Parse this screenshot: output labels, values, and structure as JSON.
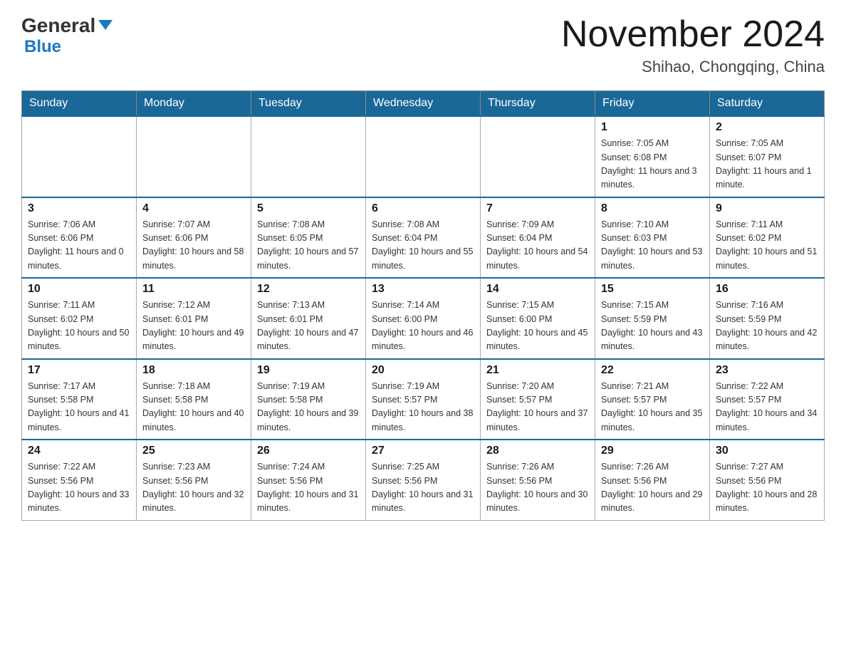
{
  "logo": {
    "text1": "General",
    "text2": "Blue"
  },
  "header": {
    "title": "November 2024",
    "subtitle": "Shihao, Chongqing, China"
  },
  "days_of_week": [
    "Sunday",
    "Monday",
    "Tuesday",
    "Wednesday",
    "Thursday",
    "Friday",
    "Saturday"
  ],
  "weeks": [
    [
      {
        "day": "",
        "info": ""
      },
      {
        "day": "",
        "info": ""
      },
      {
        "day": "",
        "info": ""
      },
      {
        "day": "",
        "info": ""
      },
      {
        "day": "",
        "info": ""
      },
      {
        "day": "1",
        "info": "Sunrise: 7:05 AM\nSunset: 6:08 PM\nDaylight: 11 hours and 3 minutes."
      },
      {
        "day": "2",
        "info": "Sunrise: 7:05 AM\nSunset: 6:07 PM\nDaylight: 11 hours and 1 minute."
      }
    ],
    [
      {
        "day": "3",
        "info": "Sunrise: 7:06 AM\nSunset: 6:06 PM\nDaylight: 11 hours and 0 minutes."
      },
      {
        "day": "4",
        "info": "Sunrise: 7:07 AM\nSunset: 6:06 PM\nDaylight: 10 hours and 58 minutes."
      },
      {
        "day": "5",
        "info": "Sunrise: 7:08 AM\nSunset: 6:05 PM\nDaylight: 10 hours and 57 minutes."
      },
      {
        "day": "6",
        "info": "Sunrise: 7:08 AM\nSunset: 6:04 PM\nDaylight: 10 hours and 55 minutes."
      },
      {
        "day": "7",
        "info": "Sunrise: 7:09 AM\nSunset: 6:04 PM\nDaylight: 10 hours and 54 minutes."
      },
      {
        "day": "8",
        "info": "Sunrise: 7:10 AM\nSunset: 6:03 PM\nDaylight: 10 hours and 53 minutes."
      },
      {
        "day": "9",
        "info": "Sunrise: 7:11 AM\nSunset: 6:02 PM\nDaylight: 10 hours and 51 minutes."
      }
    ],
    [
      {
        "day": "10",
        "info": "Sunrise: 7:11 AM\nSunset: 6:02 PM\nDaylight: 10 hours and 50 minutes."
      },
      {
        "day": "11",
        "info": "Sunrise: 7:12 AM\nSunset: 6:01 PM\nDaylight: 10 hours and 49 minutes."
      },
      {
        "day": "12",
        "info": "Sunrise: 7:13 AM\nSunset: 6:01 PM\nDaylight: 10 hours and 47 minutes."
      },
      {
        "day": "13",
        "info": "Sunrise: 7:14 AM\nSunset: 6:00 PM\nDaylight: 10 hours and 46 minutes."
      },
      {
        "day": "14",
        "info": "Sunrise: 7:15 AM\nSunset: 6:00 PM\nDaylight: 10 hours and 45 minutes."
      },
      {
        "day": "15",
        "info": "Sunrise: 7:15 AM\nSunset: 5:59 PM\nDaylight: 10 hours and 43 minutes."
      },
      {
        "day": "16",
        "info": "Sunrise: 7:16 AM\nSunset: 5:59 PM\nDaylight: 10 hours and 42 minutes."
      }
    ],
    [
      {
        "day": "17",
        "info": "Sunrise: 7:17 AM\nSunset: 5:58 PM\nDaylight: 10 hours and 41 minutes."
      },
      {
        "day": "18",
        "info": "Sunrise: 7:18 AM\nSunset: 5:58 PM\nDaylight: 10 hours and 40 minutes."
      },
      {
        "day": "19",
        "info": "Sunrise: 7:19 AM\nSunset: 5:58 PM\nDaylight: 10 hours and 39 minutes."
      },
      {
        "day": "20",
        "info": "Sunrise: 7:19 AM\nSunset: 5:57 PM\nDaylight: 10 hours and 38 minutes."
      },
      {
        "day": "21",
        "info": "Sunrise: 7:20 AM\nSunset: 5:57 PM\nDaylight: 10 hours and 37 minutes."
      },
      {
        "day": "22",
        "info": "Sunrise: 7:21 AM\nSunset: 5:57 PM\nDaylight: 10 hours and 35 minutes."
      },
      {
        "day": "23",
        "info": "Sunrise: 7:22 AM\nSunset: 5:57 PM\nDaylight: 10 hours and 34 minutes."
      }
    ],
    [
      {
        "day": "24",
        "info": "Sunrise: 7:22 AM\nSunset: 5:56 PM\nDaylight: 10 hours and 33 minutes."
      },
      {
        "day": "25",
        "info": "Sunrise: 7:23 AM\nSunset: 5:56 PM\nDaylight: 10 hours and 32 minutes."
      },
      {
        "day": "26",
        "info": "Sunrise: 7:24 AM\nSunset: 5:56 PM\nDaylight: 10 hours and 31 minutes."
      },
      {
        "day": "27",
        "info": "Sunrise: 7:25 AM\nSunset: 5:56 PM\nDaylight: 10 hours and 31 minutes."
      },
      {
        "day": "28",
        "info": "Sunrise: 7:26 AM\nSunset: 5:56 PM\nDaylight: 10 hours and 30 minutes."
      },
      {
        "day": "29",
        "info": "Sunrise: 7:26 AM\nSunset: 5:56 PM\nDaylight: 10 hours and 29 minutes."
      },
      {
        "day": "30",
        "info": "Sunrise: 7:27 AM\nSunset: 5:56 PM\nDaylight: 10 hours and 28 minutes."
      }
    ]
  ]
}
